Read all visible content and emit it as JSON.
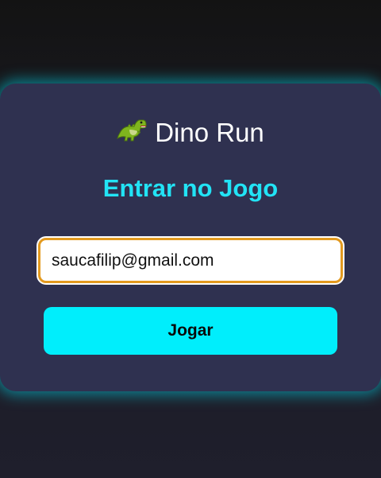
{
  "login": {
    "title": "Dino Run",
    "dino_icon": "t-rex-icon",
    "subtitle": "Entrar no Jogo",
    "email_value": "saucafilip@gmail.com",
    "play_button_label": "Jogar"
  },
  "colors": {
    "background": "#131313",
    "card": "#2f3150",
    "glow": "#00dcf0",
    "accent": "#22e3f5",
    "button": "#00eefc",
    "input_border": "#e39a1f"
  }
}
